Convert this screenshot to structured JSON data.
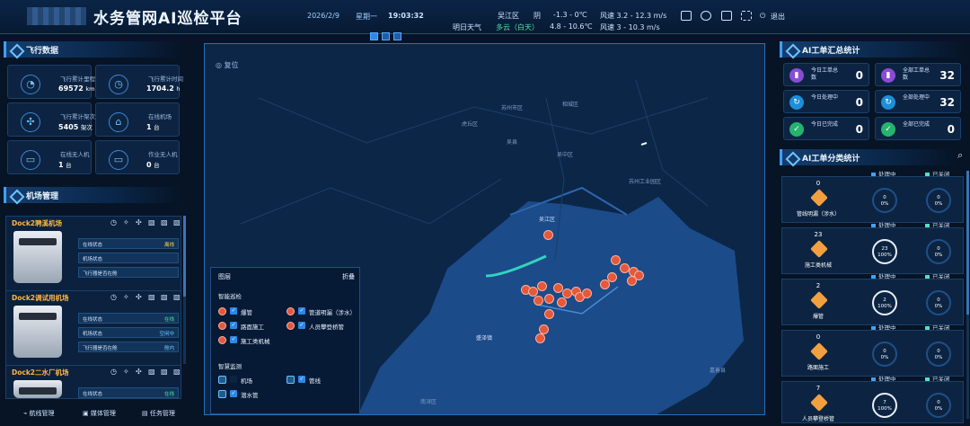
{
  "header": {
    "title": "水务管网AI巡检平台",
    "date": "2026/2/9",
    "weekday": "星期一",
    "time": "19:03:32",
    "weather_label": "明日天气",
    "location": "吴江区",
    "today_weather": "阴",
    "today_temp": "-1.3 - 0℃",
    "today_wind": "风速 3.2 - 12.3 m/s",
    "tomorrow_weather": "多云（白天）",
    "tomorrow_temp": "4.8 - 10.6℃",
    "tomorrow_wind": "风速 3 - 10.3 m/s",
    "exit_label": "退出"
  },
  "flight": {
    "title": "飞行数据",
    "cards": [
      {
        "label": "飞行累计里程",
        "value": "69572",
        "unit": "km",
        "icon": "gauge-icon"
      },
      {
        "label": "飞行累计时间",
        "value": "1704.2",
        "unit": "h",
        "icon": "clock-icon"
      },
      {
        "label": "飞行累计架次",
        "value": "5405",
        "unit": "架次",
        "icon": "drone-icon"
      },
      {
        "label": "在线机场",
        "value": "1",
        "unit": "台",
        "icon": "hangar-icon"
      },
      {
        "label": "在线无人机",
        "value": "1",
        "unit": "台",
        "icon": "drone-online-icon"
      },
      {
        "label": "作业无人机",
        "value": "0",
        "unit": "台",
        "icon": "drone-work-icon"
      }
    ]
  },
  "airport": {
    "title": "机场管理",
    "docks": [
      {
        "name": "Dock2聘溪机场",
        "rows": [
          {
            "label": "在线状态",
            "status": "离线"
          },
          {
            "label": "机场状态",
            "status": ""
          },
          {
            "label": "飞行器是否在舱",
            "status": ""
          }
        ]
      },
      {
        "name": "Dock2调试用机场",
        "rows": [
          {
            "label": "在线状态",
            "status": "在线"
          },
          {
            "label": "机场状态",
            "status": "空闲中"
          },
          {
            "label": "飞行器是否在舱",
            "status": "舱内"
          }
        ]
      },
      {
        "name": "Dock2二水厂机场",
        "rows": [
          {
            "label": "在线状态",
            "status": "在线"
          }
        ]
      }
    ]
  },
  "bottom_nav": [
    "航线管理",
    "媒体管理",
    "任务管理"
  ],
  "map": {
    "reset_label": "复位",
    "places": [
      "吴江区",
      "吴中区",
      "南浔区",
      "嘉善县",
      "苏州市区",
      "虎丘区",
      "相城区",
      "苏州工业园区",
      "吴县",
      "盛泽镇"
    ],
    "layers": {
      "title": "图层",
      "collapse": "折叠",
      "section1": "智能巡检",
      "items1": [
        "爆管",
        "管道明漏（涉水）",
        "路面施工",
        "人员攀登桥管",
        "施工类机械"
      ],
      "section2": "智慧监测",
      "items2": [
        "机场",
        "管线",
        "潜水管"
      ]
    }
  },
  "summary": {
    "title": "AI工单汇总统计",
    "items": [
      {
        "label": "今日工单总数",
        "value": "0",
        "color": "#8a4bd6",
        "icon": "bar-chart-icon"
      },
      {
        "label": "全部工单总数",
        "value": "32",
        "color": "#8a4bd6",
        "icon": "bar-chart-icon"
      },
      {
        "label": "今日处理中",
        "value": "0",
        "color": "#1d8fd8",
        "icon": "refresh-icon"
      },
      {
        "label": "全部处理中",
        "value": "32",
        "color": "#1d8fd8",
        "icon": "refresh-icon"
      },
      {
        "label": "今日已完成",
        "value": "0",
        "color": "#25b36e",
        "icon": "check-icon"
      },
      {
        "label": "全部已完成",
        "value": "0",
        "color": "#25b36e",
        "icon": "check-icon"
      }
    ]
  },
  "category": {
    "title": "AI工单分类统计",
    "legend_processing": "处理中",
    "legend_closed": "已关闭",
    "items": [
      {
        "name": "管线明漏（涉水）",
        "count": "0",
        "processing": "0",
        "processing_pct": "0%",
        "closed": "0",
        "closed_pct": "0%"
      },
      {
        "name": "施工类机械",
        "count": "23",
        "processing": "23",
        "processing_pct": "100%",
        "closed": "0",
        "closed_pct": "0%"
      },
      {
        "name": "爆管",
        "count": "2",
        "processing": "2",
        "processing_pct": "100%",
        "closed": "0",
        "closed_pct": "0%"
      },
      {
        "name": "路面施工",
        "count": "0",
        "processing": "0",
        "processing_pct": "0%",
        "closed": "0",
        "closed_pct": "0%"
      },
      {
        "name": "人员攀登桥管",
        "count": "7",
        "processing": "7",
        "processing_pct": "100%",
        "closed": "0",
        "closed_pct": "0%"
      }
    ]
  }
}
